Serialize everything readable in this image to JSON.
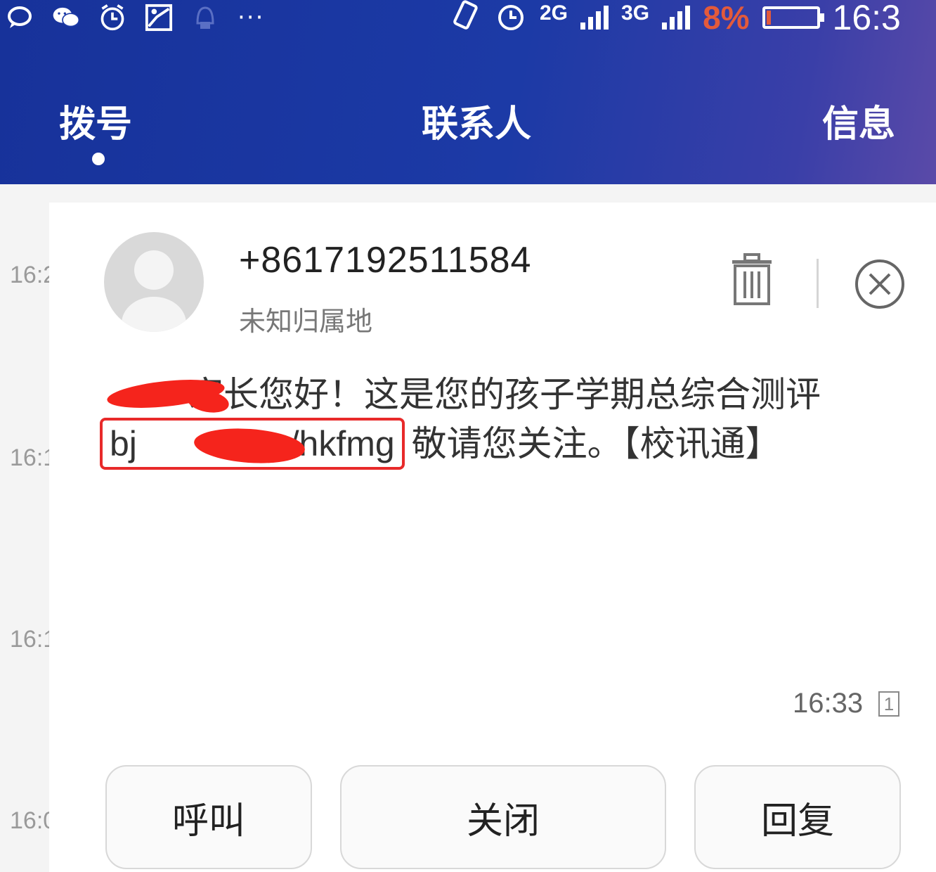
{
  "status_bar": {
    "icons": [
      "chat-bubble-icon",
      "wechat-icon",
      "alarm-icon",
      "image-icon",
      "notification-icon",
      "more-dots-icon"
    ],
    "more": "···",
    "net1": "2G",
    "net2": "3G",
    "battery_percent": "8%",
    "battery_level": 0.08,
    "time": "16:3"
  },
  "tabs": [
    {
      "label": "拨号",
      "active": true
    },
    {
      "label": "联系人",
      "active": false
    },
    {
      "label": "信息",
      "active": false
    }
  ],
  "background_times": [
    "16:2",
    "16:1",
    "16:1",
    "16:0"
  ],
  "popup": {
    "sender": "+8617192511584",
    "location": "未知归属地",
    "message_part1": "家长您好！这是您的孩子学期总综合测评",
    "link_prefix": "bj",
    "link_suffix": ".cn/hkfmg",
    "message_part2": "敬请您关注。【校讯通】",
    "time": "16:33",
    "sim": "1",
    "buttons": {
      "call": "呼叫",
      "close": "关闭",
      "reply": "回复"
    }
  },
  "colors": {
    "header_blue": "#1c3aa6",
    "highlight_red": "#e82a2a",
    "battery_red": "#e35a3b"
  }
}
